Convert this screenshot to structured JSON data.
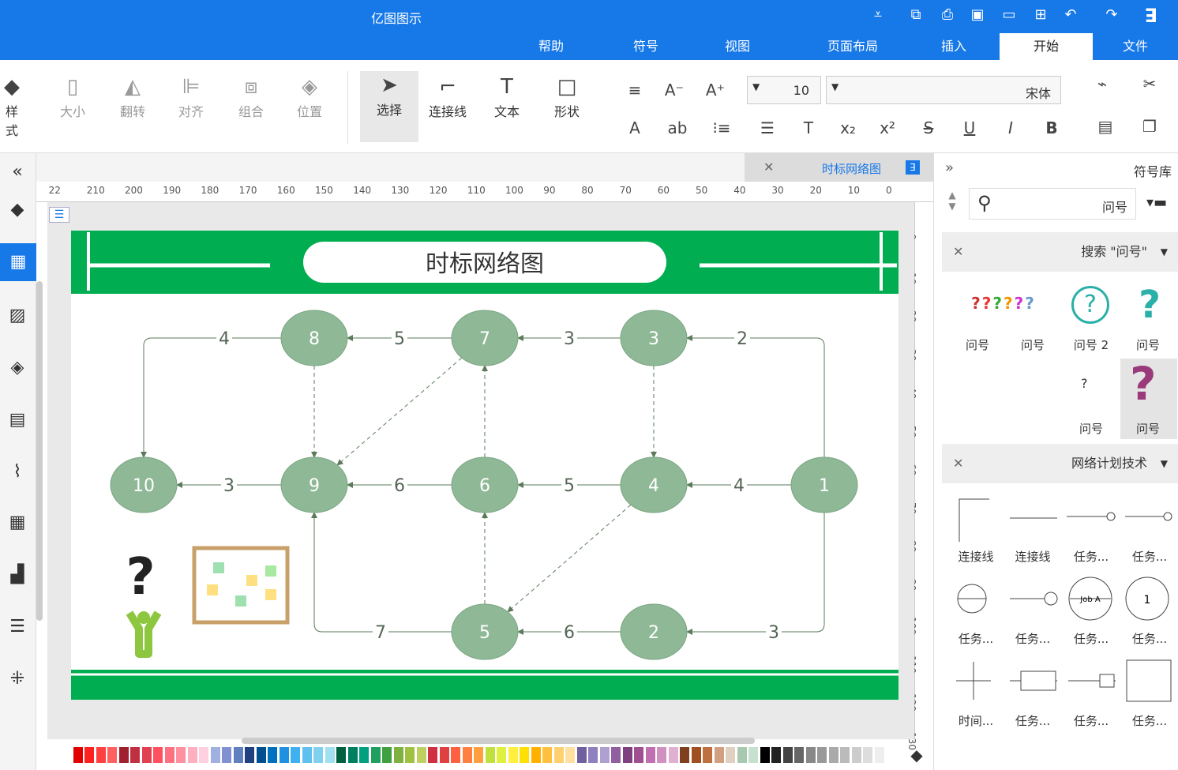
{
  "app": {
    "title": "亿图图示"
  },
  "tabs": [
    {
      "label": "文件"
    },
    {
      "label": "开始"
    },
    {
      "label": "插入"
    },
    {
      "label": "页面布局"
    },
    {
      "label": "视图"
    },
    {
      "label": "符号"
    },
    {
      "label": "帮助"
    }
  ],
  "ribbon": {
    "font_name": "宋体",
    "font_size": "10",
    "tools": [
      {
        "label": "形状"
      },
      {
        "label": "文本"
      },
      {
        "label": "连接线"
      },
      {
        "label": "选择"
      }
    ],
    "arrange": [
      {
        "label": "位置"
      },
      {
        "label": "组合"
      },
      {
        "label": "对齐"
      },
      {
        "label": "翻转"
      },
      {
        "label": "大小"
      }
    ],
    "style_label": "样式"
  },
  "doc_tab": {
    "title": "时标网络图"
  },
  "ruler": {
    "h_ticks": [
      "0",
      "10",
      "20",
      "30",
      "40",
      "50",
      "60",
      "70",
      "80",
      "90",
      "100",
      "110",
      "120",
      "130",
      "140",
      "150",
      "160",
      "170",
      "180",
      "190",
      "200",
      "210",
      "22"
    ],
    "v_ticks": [
      "0",
      "10",
      "20",
      "30",
      "40",
      "50",
      "60",
      "70",
      "80",
      "90",
      "100",
      "110",
      "120",
      "130"
    ]
  },
  "diagram": {
    "title": "时标网络图",
    "nodes": [
      {
        "id": "1"
      },
      {
        "id": "2"
      },
      {
        "id": "3"
      },
      {
        "id": "4"
      },
      {
        "id": "5"
      },
      {
        "id": "6"
      },
      {
        "id": "7"
      },
      {
        "id": "8"
      },
      {
        "id": "9"
      },
      {
        "id": "10"
      }
    ],
    "edges": [
      {
        "from": "1",
        "to": "3",
        "label": "2"
      },
      {
        "from": "3",
        "to": "7",
        "label": "3"
      },
      {
        "from": "7",
        "to": "8",
        "label": "5"
      },
      {
        "from": "8",
        "to": "10",
        "label": "4"
      },
      {
        "from": "1",
        "to": "4",
        "label": "4"
      },
      {
        "from": "4",
        "to": "6",
        "label": "5"
      },
      {
        "from": "6",
        "to": "9",
        "label": "6"
      },
      {
        "from": "9",
        "to": "10",
        "label": "3"
      },
      {
        "from": "1",
        "to": "2",
        "label": "3"
      },
      {
        "from": "2",
        "to": "5",
        "label": "6"
      },
      {
        "from": "5",
        "to": "9",
        "label": "7"
      },
      {
        "from": "3",
        "to": "4",
        "label": ""
      },
      {
        "from": "8",
        "to": "9",
        "label": ""
      },
      {
        "from": "5",
        "to": "6",
        "label": ""
      },
      {
        "from": "6",
        "to": "7",
        "label": ""
      },
      {
        "from": "7",
        "to": "9",
        "label": ""
      },
      {
        "from": "4",
        "to": "5",
        "label": ""
      }
    ]
  },
  "right_panel": {
    "title": "符号库",
    "search_value": "问号",
    "section1_title": "搜索 \"问号\"",
    "sec1_labels": [
      "问号",
      "问号 2",
      "问号",
      "问号",
      "问号",
      "问号"
    ],
    "section2_title": "网络计划技术",
    "sec2_labels": [
      "任务...",
      "任务...",
      "连接线",
      "连接线",
      "任务...",
      "任务...",
      "任务...",
      "任务...",
      "任务...",
      "任务...",
      "任务...",
      "时间..."
    ]
  },
  "colors": {
    "accent": "#1778e8",
    "green": "#00ad50",
    "node": "#8fb996",
    "edge": "#5a7a5a"
  }
}
